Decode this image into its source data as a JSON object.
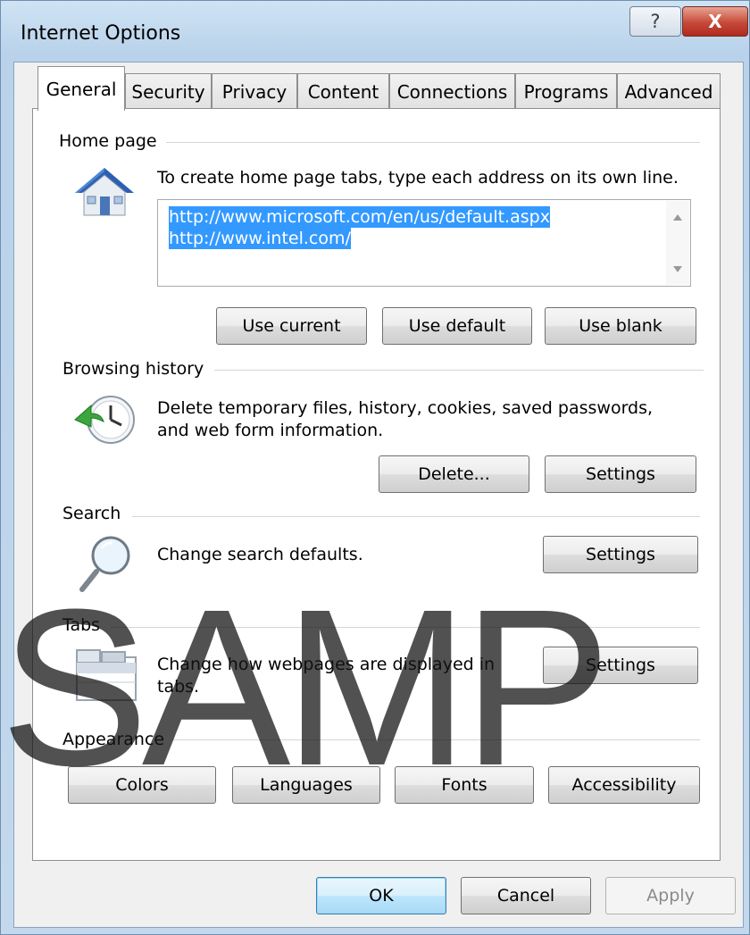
{
  "window": {
    "title": "Internet Options",
    "help_label": "?",
    "close_label": "X"
  },
  "tabs": [
    "General",
    "Security",
    "Privacy",
    "Content",
    "Connections",
    "Programs",
    "Advanced"
  ],
  "home_page": {
    "group_label": "Home page",
    "instruction": "To create home page tabs, type each address on its own line.",
    "addresses": [
      "http://www.microsoft.com/en/us/default.aspx",
      "http://www.intel.com/"
    ],
    "buttons": {
      "use_current": "Use current",
      "use_default": "Use default",
      "use_blank": "Use blank"
    }
  },
  "browsing_history": {
    "group_label": "Browsing history",
    "text_line1": "Delete temporary files, history, cookies, saved passwords,",
    "text_line2": "and web form information.",
    "buttons": {
      "delete": "Delete...",
      "settings": "Settings"
    }
  },
  "search": {
    "group_label": "Search",
    "text": "Change search defaults.",
    "settings": "Settings"
  },
  "tabs_section": {
    "group_label": "Tabs",
    "text_line1": "Change how webpages are displayed in",
    "text_line2": "tabs.",
    "settings": "Settings"
  },
  "appearance": {
    "group_label": "Appearance",
    "buttons": {
      "colors": "Colors",
      "languages": "Languages",
      "fonts": "Fonts",
      "accessibility": "Accessibility"
    }
  },
  "footer": {
    "ok": "OK",
    "cancel": "Cancel",
    "apply": "Apply"
  },
  "watermark": "SAMP",
  "icons": {
    "home": "house-icon",
    "history": "clock-arrow-icon",
    "search": "magnifier-icon",
    "tabs": "tabs-window-icon"
  }
}
